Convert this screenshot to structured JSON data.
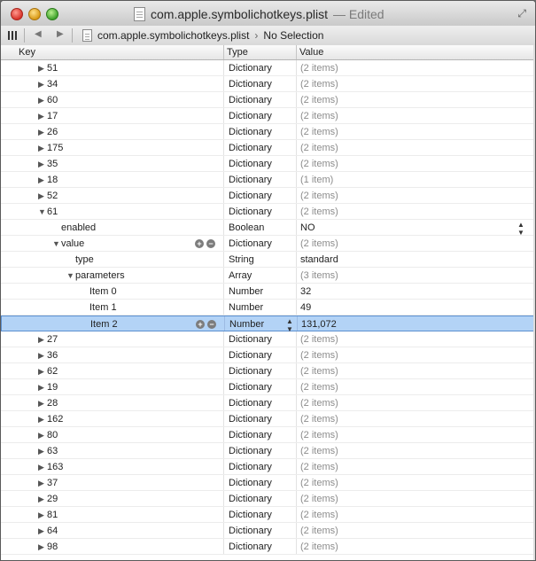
{
  "window": {
    "title": "com.apple.symbolichotkeys.plist",
    "edited": "— Edited"
  },
  "pathbar": {
    "file": "com.apple.symbolichotkeys.plist",
    "chevron": "›",
    "selection": "No Selection"
  },
  "columns": {
    "key": "Key",
    "type": "Type",
    "value": "Value"
  },
  "colors": {
    "selection": "#b3d3f6",
    "selection_border": "#5b8fd0"
  },
  "icons": {
    "fullscreen": "⤢",
    "back": "◀",
    "forward": "▶",
    "add": "+",
    "remove": "−",
    "collapsed": "▶",
    "expanded": "▼",
    "stepper": "▲▼"
  },
  "rows": [
    {
      "key": "51",
      "type": "Dictionary",
      "value": "(2 items)",
      "level": 0,
      "disclosure": "collapsed",
      "count": true
    },
    {
      "key": "34",
      "type": "Dictionary",
      "value": "(2 items)",
      "level": 0,
      "disclosure": "collapsed",
      "count": true
    },
    {
      "key": "60",
      "type": "Dictionary",
      "value": "(2 items)",
      "level": 0,
      "disclosure": "collapsed",
      "count": true
    },
    {
      "key": "17",
      "type": "Dictionary",
      "value": "(2 items)",
      "level": 0,
      "disclosure": "collapsed",
      "count": true
    },
    {
      "key": "26",
      "type": "Dictionary",
      "value": "(2 items)",
      "level": 0,
      "disclosure": "collapsed",
      "count": true
    },
    {
      "key": "175",
      "type": "Dictionary",
      "value": "(2 items)",
      "level": 0,
      "disclosure": "collapsed",
      "count": true
    },
    {
      "key": "35",
      "type": "Dictionary",
      "value": "(2 items)",
      "level": 0,
      "disclosure": "collapsed",
      "count": true
    },
    {
      "key": "18",
      "type": "Dictionary",
      "value": "(1 item)",
      "level": 0,
      "disclosure": "collapsed",
      "count": true
    },
    {
      "key": "52",
      "type": "Dictionary",
      "value": "(2 items)",
      "level": 0,
      "disclosure": "collapsed",
      "count": true
    },
    {
      "key": "61",
      "type": "Dictionary",
      "value": "(2 items)",
      "level": 0,
      "disclosure": "expanded",
      "count": true
    },
    {
      "key": "enabled",
      "type": "Boolean",
      "value": "NO",
      "level": 1,
      "disclosure": "none",
      "count": false,
      "stepper": true
    },
    {
      "key": "value",
      "type": "Dictionary",
      "value": "(2 items)",
      "level": 1,
      "disclosure": "expanded",
      "count": true,
      "buttons": true
    },
    {
      "key": "type",
      "type": "String",
      "value": "standard",
      "level": 2,
      "disclosure": "none",
      "count": false
    },
    {
      "key": "parameters",
      "type": "Array",
      "value": "(3 items)",
      "level": 2,
      "disclosure": "expanded",
      "count": true
    },
    {
      "key": "Item 0",
      "type": "Number",
      "value": "32",
      "level": 3,
      "disclosure": "none",
      "count": false
    },
    {
      "key": "Item 1",
      "type": "Number",
      "value": "49",
      "level": 3,
      "disclosure": "none",
      "count": false
    },
    {
      "key": "Item 2",
      "type": "Number",
      "value": "131,072",
      "level": 3,
      "disclosure": "none",
      "count": false,
      "selected": true,
      "buttons": true,
      "typestepper": true
    },
    {
      "key": "27",
      "type": "Dictionary",
      "value": "(2 items)",
      "level": 0,
      "disclosure": "collapsed",
      "count": true
    },
    {
      "key": "36",
      "type": "Dictionary",
      "value": "(2 items)",
      "level": 0,
      "disclosure": "collapsed",
      "count": true
    },
    {
      "key": "62",
      "type": "Dictionary",
      "value": "(2 items)",
      "level": 0,
      "disclosure": "collapsed",
      "count": true
    },
    {
      "key": "19",
      "type": "Dictionary",
      "value": "(2 items)",
      "level": 0,
      "disclosure": "collapsed",
      "count": true
    },
    {
      "key": "28",
      "type": "Dictionary",
      "value": "(2 items)",
      "level": 0,
      "disclosure": "collapsed",
      "count": true
    },
    {
      "key": "162",
      "type": "Dictionary",
      "value": "(2 items)",
      "level": 0,
      "disclosure": "collapsed",
      "count": true
    },
    {
      "key": "80",
      "type": "Dictionary",
      "value": "(2 items)",
      "level": 0,
      "disclosure": "collapsed",
      "count": true
    },
    {
      "key": "63",
      "type": "Dictionary",
      "value": "(2 items)",
      "level": 0,
      "disclosure": "collapsed",
      "count": true
    },
    {
      "key": "163",
      "type": "Dictionary",
      "value": "(2 items)",
      "level": 0,
      "disclosure": "collapsed",
      "count": true
    },
    {
      "key": "37",
      "type": "Dictionary",
      "value": "(2 items)",
      "level": 0,
      "disclosure": "collapsed",
      "count": true
    },
    {
      "key": "29",
      "type": "Dictionary",
      "value": "(2 items)",
      "level": 0,
      "disclosure": "collapsed",
      "count": true
    },
    {
      "key": "81",
      "type": "Dictionary",
      "value": "(2 items)",
      "level": 0,
      "disclosure": "collapsed",
      "count": true
    },
    {
      "key": "64",
      "type": "Dictionary",
      "value": "(2 items)",
      "level": 0,
      "disclosure": "collapsed",
      "count": true
    },
    {
      "key": "98",
      "type": "Dictionary",
      "value": "(2 items)",
      "level": 0,
      "disclosure": "collapsed",
      "count": true
    }
  ]
}
